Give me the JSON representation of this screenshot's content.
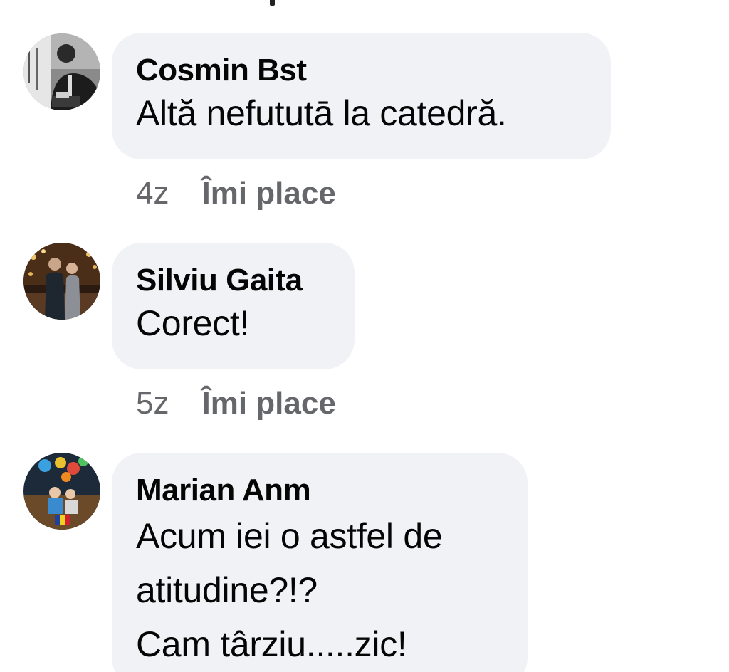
{
  "comments": [
    {
      "author": "Cosmin Bst",
      "lines": [
        "Altă nefututā la catedră."
      ],
      "time": "4z",
      "like_label": "Îmi place",
      "avatar_icon": "profile-photo-grayscale"
    },
    {
      "author": "Silviu Gaita",
      "lines": [
        "Corect!"
      ],
      "time": "5z",
      "like_label": "Îmi place",
      "avatar_icon": "profile-photo-couple"
    },
    {
      "author": "Marian Anm",
      "lines": [
        "Acum iei o astfel de",
        "atitudine?!?",
        "Cam târziu.....zic!"
      ],
      "avatar_icon": "profile-photo-balloons"
    }
  ],
  "colors": {
    "bubble": "#f0f2f5",
    "text": "#050505",
    "meta": "#65676b"
  }
}
